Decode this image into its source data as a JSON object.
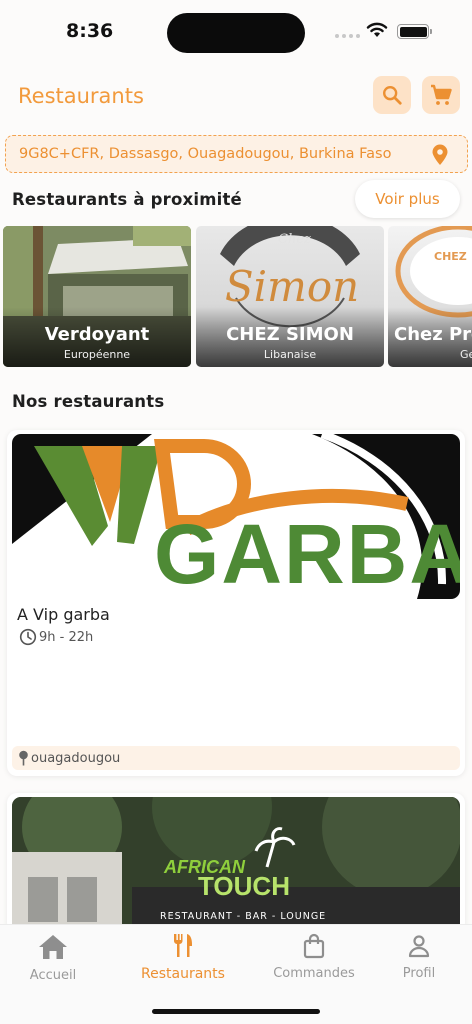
{
  "status": {
    "time": "8:36"
  },
  "header": {
    "title": "Restaurants"
  },
  "location": {
    "address": "9G8C+CFR, Dassasgo, Ouagadougou, Burkina Faso"
  },
  "nearby": {
    "title": "Restaurants à proximité",
    "see_more": "Voir plus",
    "items": [
      {
        "name": "Verdoyant",
        "cuisine": "Européenne"
      },
      {
        "name": "CHEZ SIMON",
        "cuisine": "Libanaise",
        "logo_text": "Simon",
        "logo_small": "Chez"
      },
      {
        "name": "Chez Prés",
        "cuisine": "Ge",
        "logo_small": "CHEZ"
      }
    ]
  },
  "ours": {
    "title": "Nos restaurants",
    "items": [
      {
        "name": "A Vip garba",
        "hours": "9h - 22h",
        "city": "ouagadougou",
        "logo_a": "VIP",
        "logo_b": "GARBA"
      },
      {
        "logo_a": "AFRICAN",
        "logo_b": "TOUCH",
        "tagline": "RESTAURANT - BAR - LOUNGE"
      }
    ]
  },
  "tabs": [
    {
      "label": "Accueil",
      "icon": "home-icon",
      "active": false
    },
    {
      "label": "Restaurants",
      "icon": "utensils-icon",
      "active": true
    },
    {
      "label": "Commandes",
      "icon": "bag-icon",
      "active": false
    },
    {
      "label": "Profil",
      "icon": "person-icon",
      "active": false
    }
  ],
  "colors": {
    "accent": "#ec9032",
    "accent_soft": "#fde2c7",
    "text": "#1f1f1f"
  }
}
